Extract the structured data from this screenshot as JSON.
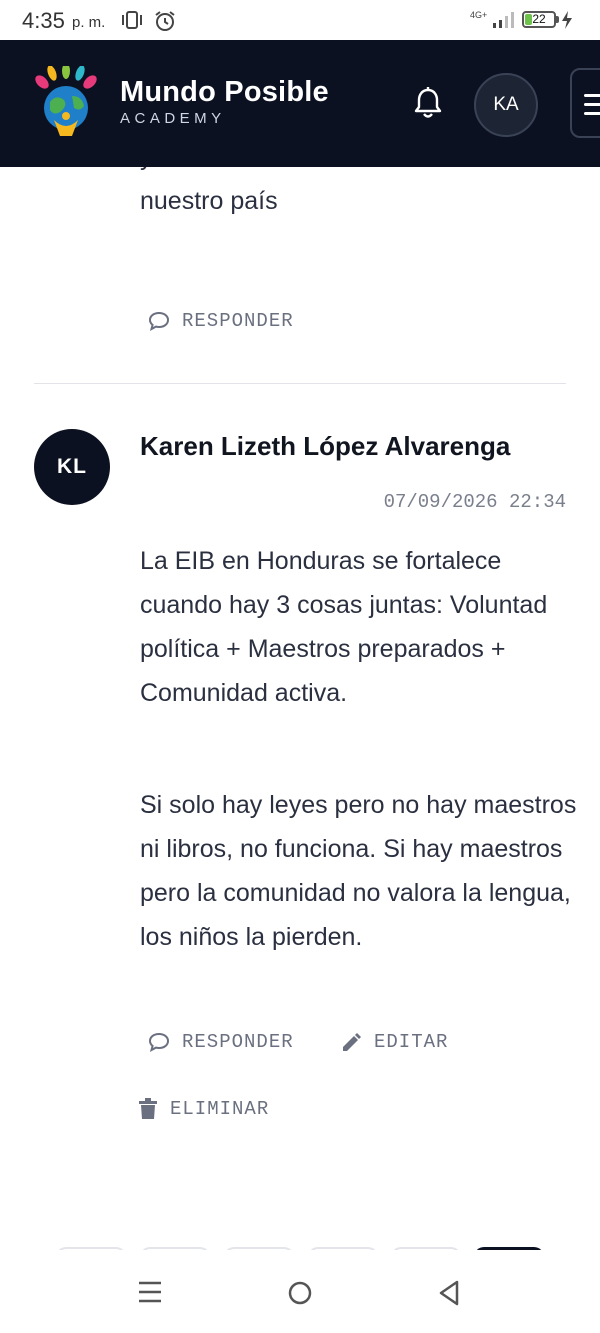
{
  "status_bar": {
    "time": "4:35",
    "ampm": "p. m.",
    "network": "4G+",
    "battery_level": "22"
  },
  "header": {
    "brand_title": "Mundo Posible",
    "brand_subtitle": "ACADEMY",
    "user_initials": "KA"
  },
  "previous_comment": {
    "body_tail": "y necesidad de la interculturalidad en nuestro país",
    "reply_label": "RESPONDER"
  },
  "comment": {
    "avatar_initials": "KL",
    "author": "Karen Lizeth López Alvarenga",
    "timestamp": "07/09/2026 22:34",
    "paragraphs": [
      "La EIB en Honduras se fortalece cuando hay 3 cosas juntas: Voluntad política + Maestros preparados + Comunidad activa.",
      "Si solo hay leyes pero no hay maestros ni libros, no funciona. Si hay maestros pero la comunidad no valora la lengua, los niños la pierden."
    ],
    "actions": {
      "reply": "RESPONDER",
      "edit": "EDITAR",
      "delete": "ELIMINAR"
    }
  }
}
